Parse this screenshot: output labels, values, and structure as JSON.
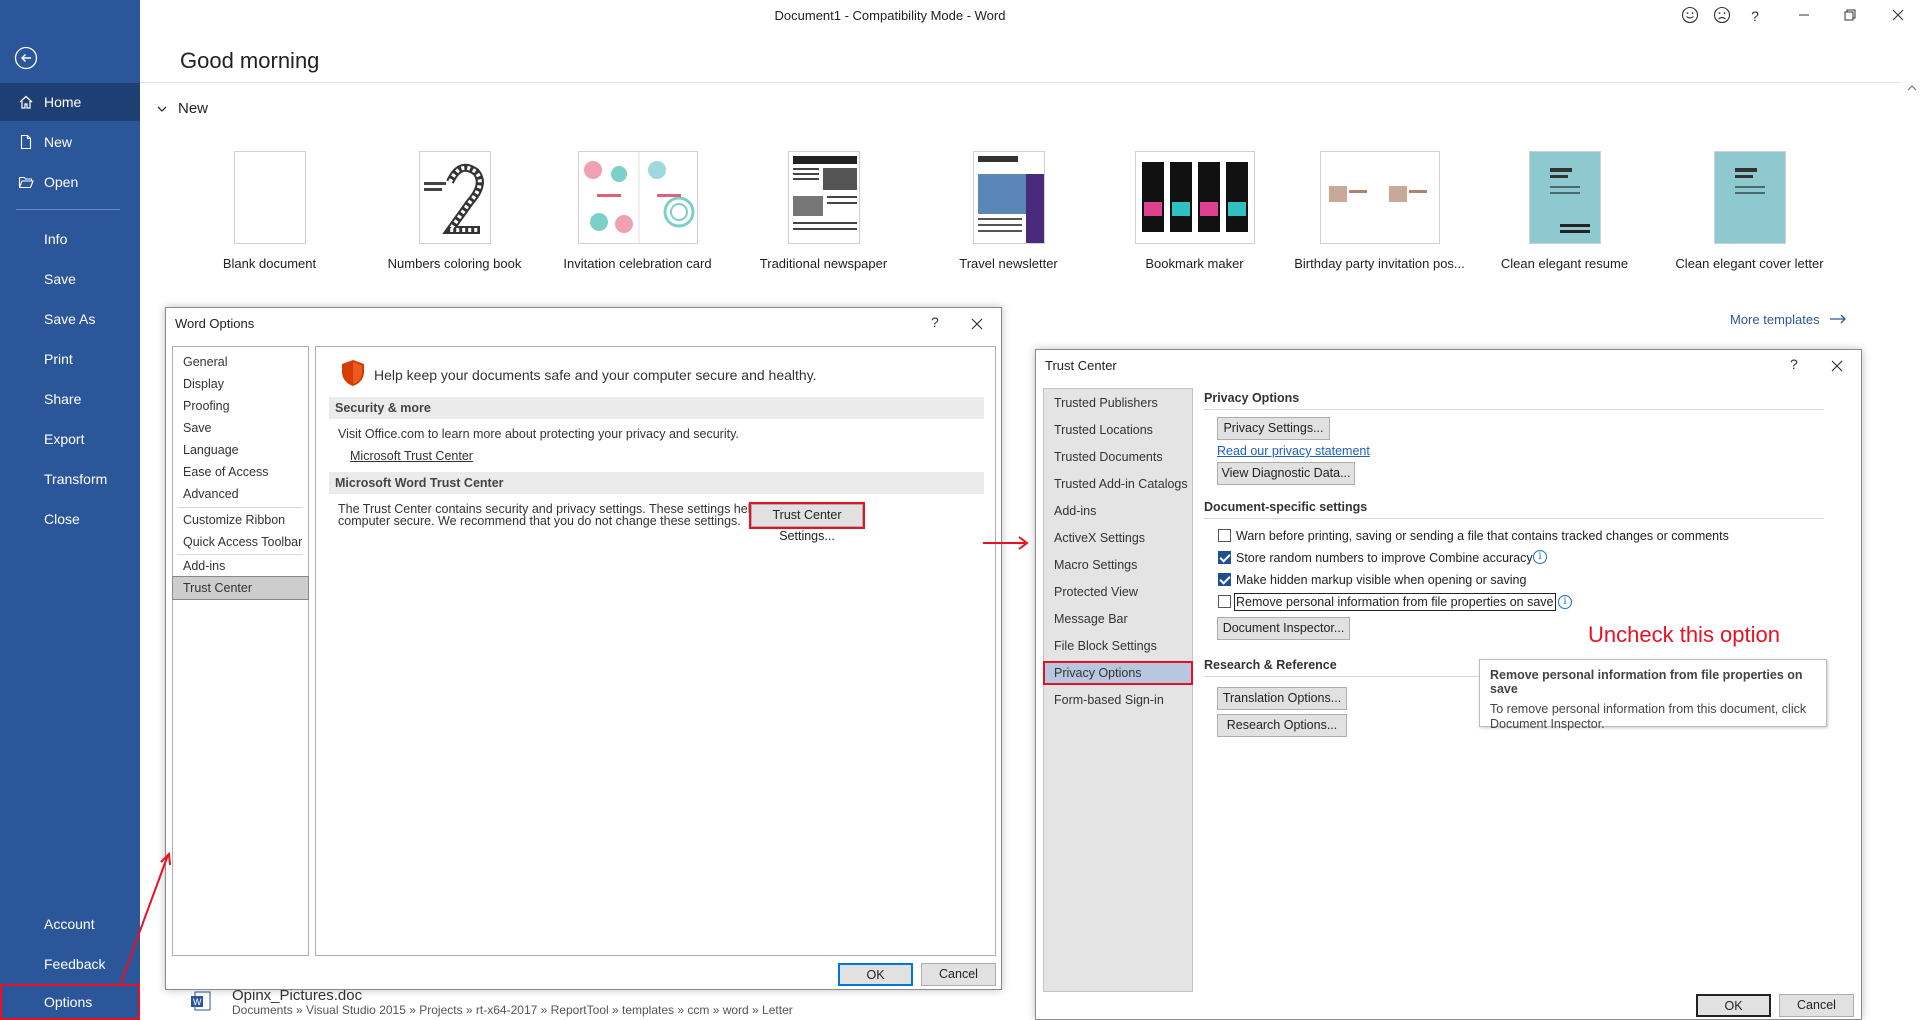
{
  "window": {
    "title": "Document1  -  Compatibility Mode  -  Word"
  },
  "nav": {
    "items": [
      {
        "label": "Home"
      },
      {
        "label": "New"
      },
      {
        "label": "Open"
      },
      {
        "label": "Info"
      },
      {
        "label": "Save"
      },
      {
        "label": "Save As"
      },
      {
        "label": "Print"
      },
      {
        "label": "Share"
      },
      {
        "label": "Export"
      },
      {
        "label": "Transform"
      },
      {
        "label": "Close"
      },
      {
        "label": "Account"
      },
      {
        "label": "Feedback"
      },
      {
        "label": "Options"
      }
    ]
  },
  "home": {
    "greeting": "Good morning",
    "new_heading": "New",
    "templates": [
      {
        "name": "Blank document"
      },
      {
        "name": "Numbers coloring book"
      },
      {
        "name": "Invitation celebration card"
      },
      {
        "name": "Traditional newspaper"
      },
      {
        "name": "Travel newsletter"
      },
      {
        "name": "Bookmark maker"
      },
      {
        "name": "Birthday party invitation pos..."
      },
      {
        "name": "Clean elegant resume"
      },
      {
        "name": "Clean elegant cover letter"
      }
    ],
    "more_templates": "More templates",
    "recent_file": "Opinx_Pictures.doc",
    "recent_path": "Documents » Visual Studio 2015 » Projects » rt-x64-2017 » ReportTool » templates » ccm » word » Letter"
  },
  "word_options": {
    "title": "Word Options",
    "help": "?",
    "nav": [
      {
        "label": "General"
      },
      {
        "label": "Display"
      },
      {
        "label": "Proofing"
      },
      {
        "label": "Save"
      },
      {
        "label": "Language"
      },
      {
        "label": "Ease of Access"
      },
      {
        "label": "Advanced"
      },
      {
        "label": "Customize Ribbon"
      },
      {
        "label": "Quick Access Toolbar"
      },
      {
        "label": "Add-ins"
      },
      {
        "label": "Trust Center"
      }
    ],
    "lead": "Help keep your documents safe and your computer secure and healthy.",
    "section1_title": "Security & more",
    "section1_text": "Visit Office.com to learn more about protecting your privacy and security.",
    "section1_link": "Microsoft Trust Center",
    "section2_title": "Microsoft Word Trust Center",
    "section2_text_1": "The Trust Center contains security and privacy settings. These settings help keep your",
    "section2_text_2": "computer secure. We recommend that you do not change these settings.",
    "settings_button": "Trust Center Settings...",
    "ok": "OK",
    "cancel": "Cancel"
  },
  "trust_center": {
    "title": "Trust Center",
    "help": "?",
    "nav": [
      {
        "label": "Trusted Publishers"
      },
      {
        "label": "Trusted Locations"
      },
      {
        "label": "Trusted Documents"
      },
      {
        "label": "Trusted Add-in Catalogs"
      },
      {
        "label": "Add-ins"
      },
      {
        "label": "ActiveX Settings"
      },
      {
        "label": "Macro Settings"
      },
      {
        "label": "Protected View"
      },
      {
        "label": "Message Bar"
      },
      {
        "label": "File Block Settings"
      },
      {
        "label": "Privacy Options"
      },
      {
        "label": "Form-based Sign-in"
      }
    ],
    "privacy_heading": "Privacy Options",
    "privacy_settings_btn": "Privacy Settings...",
    "privacy_statement_link": "Read our privacy statement",
    "diagnostic_btn": "View Diagnostic Data...",
    "doc_heading": "Document-specific settings",
    "checkboxes": [
      {
        "label": "Warn before printing, saving or sending a file that contains tracked changes or comments",
        "checked": false
      },
      {
        "label": "Store random numbers to improve Combine accuracy",
        "checked": true
      },
      {
        "label": "Make hidden markup visible when opening or saving",
        "checked": true
      },
      {
        "label": "Remove personal information from file properties on save",
        "checked": false
      }
    ],
    "doc_inspector_btn": "Document Inspector...",
    "research_heading": "Research & Reference",
    "translation_btn": "Translation Options...",
    "research_btn": "Research Options...",
    "ok": "OK",
    "cancel": "Cancel",
    "tooltip_title": "Remove personal information from file properties on save",
    "tooltip_body_1": "To remove personal information from this document, click",
    "tooltip_body_2": "Document Inspector."
  },
  "annotation": {
    "text": "Uncheck this option",
    "color": "#e81123"
  },
  "colors": {
    "nav_bg": "#2b579a",
    "accent": "#2b579a",
    "highlight": "#e81123"
  }
}
